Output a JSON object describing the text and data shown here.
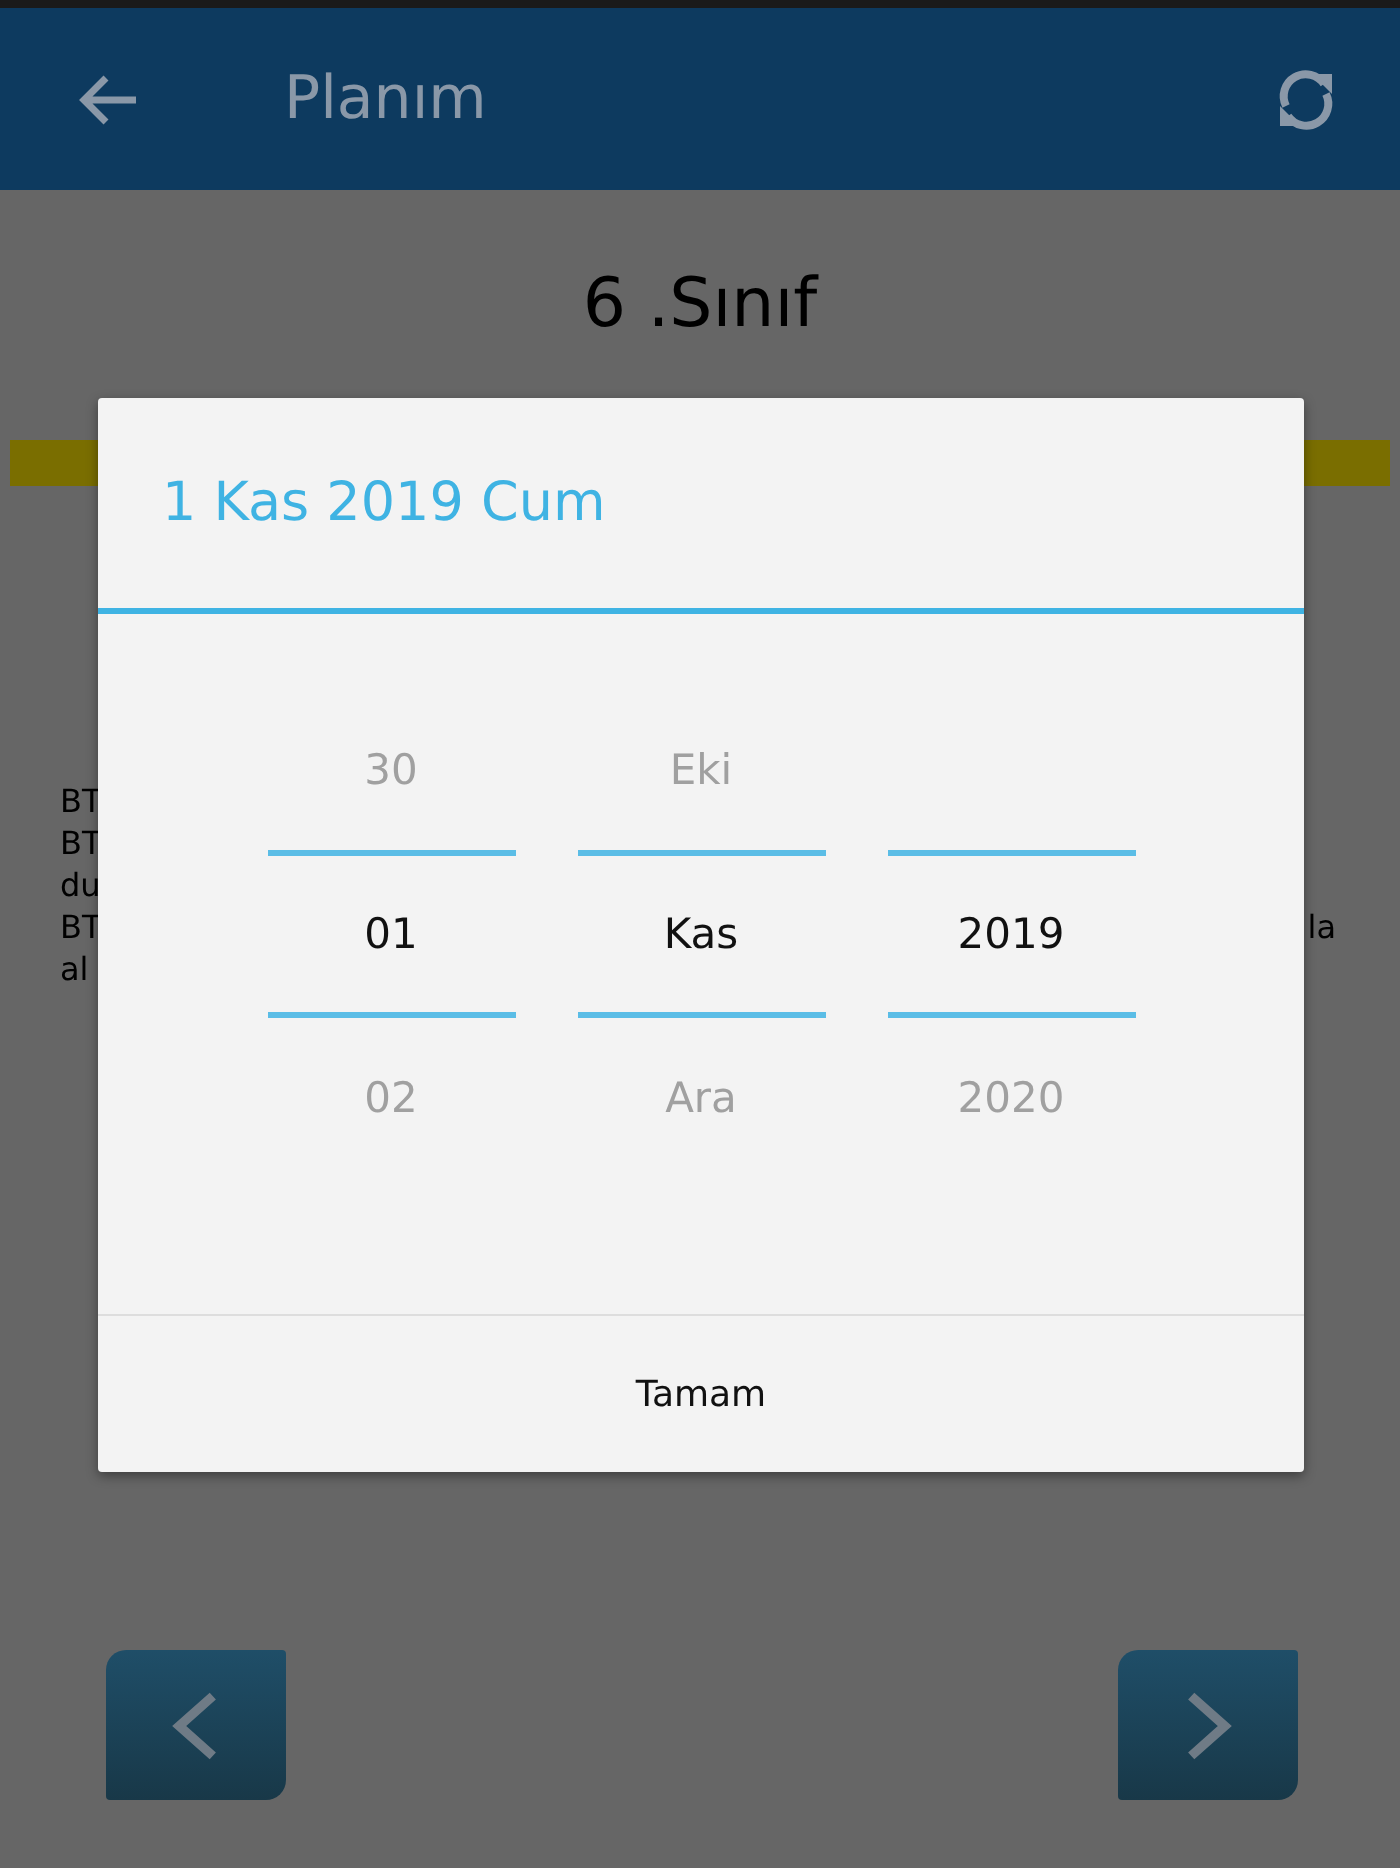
{
  "app_bar": {
    "title": "Planım"
  },
  "page": {
    "heading": "6 .Sınıf",
    "left_fragments": [
      "BT",
      "BT",
      "du",
      "BT",
      "al"
    ],
    "right_fragment": "la"
  },
  "dialog": {
    "title": "1 Kas 2019 Cum",
    "columns": [
      {
        "items": [
          {
            "text": "30",
            "selected": false
          },
          {
            "text": "01",
            "selected": true
          },
          {
            "text": "02",
            "selected": false
          }
        ]
      },
      {
        "items": [
          {
            "text": "Eki",
            "selected": false
          },
          {
            "text": "Kas",
            "selected": true
          },
          {
            "text": "Ara",
            "selected": false
          }
        ]
      },
      {
        "items": [
          {
            "text": "2019",
            "selected": true
          },
          {
            "text": "2020",
            "selected": false
          }
        ]
      }
    ],
    "button": "Tamam"
  }
}
